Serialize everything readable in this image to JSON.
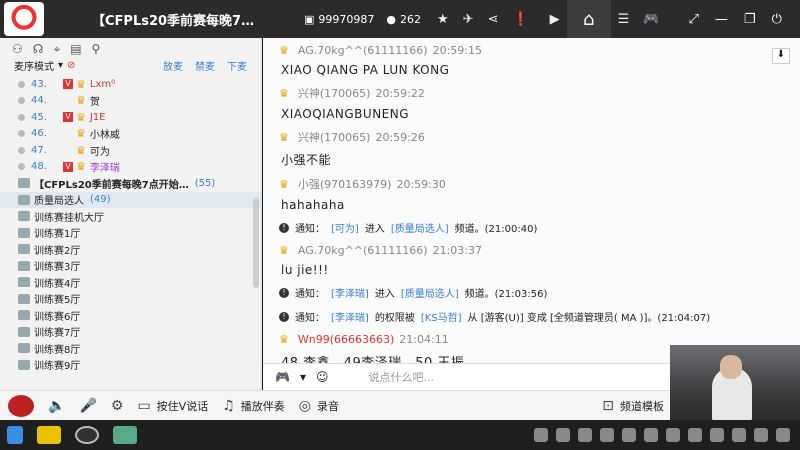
{
  "title_bar": {
    "room_title": "【CFPLs20季前赛每晚7…",
    "room_id": "99970987",
    "online_count": "262"
  },
  "left_panel": {
    "sort_mode": "麦序模式",
    "links": [
      "放麦",
      "禁麦",
      "下麦"
    ],
    "queue": [
      {
        "num": "43.",
        "name": "Lxm⁰",
        "v": true,
        "color": "#c33"
      },
      {
        "num": "44.",
        "name": "贺",
        "v": false,
        "color": "#222"
      },
      {
        "num": "45.",
        "name": "J1E",
        "v": true,
        "color": "#c33"
      },
      {
        "num": "46.",
        "name": "小林威",
        "v": false,
        "color": "#222"
      },
      {
        "num": "47.",
        "name": "可为",
        "v": false,
        "color": "#222"
      },
      {
        "num": "48.",
        "name": "李泽瑞",
        "v": true,
        "color": "#9a3bd1"
      }
    ],
    "channels": [
      {
        "name": "【CFPLs20季前赛每晚7点开始…",
        "count": "(55)",
        "bold": true
      },
      {
        "name": "质量局选人",
        "count": "(49)",
        "active": true
      },
      {
        "name": "训练赛挂机大厅",
        "count": ""
      },
      {
        "name": "训练赛1厅",
        "count": ""
      },
      {
        "name": "训练赛2厅",
        "count": ""
      },
      {
        "name": "训练赛3厅",
        "count": ""
      },
      {
        "name": "训练赛4厅",
        "count": ""
      },
      {
        "name": "训练赛5厅",
        "count": ""
      },
      {
        "name": "训练赛6厅",
        "count": ""
      },
      {
        "name": "训练赛7厅",
        "count": ""
      },
      {
        "name": "训练赛8厅",
        "count": ""
      },
      {
        "name": "训练赛9厅",
        "count": ""
      }
    ]
  },
  "chat": {
    "m1_user": "AG.70kg^^(61111166)",
    "m1_time": "20:59:15",
    "m1_text": "XIAO QIANG PA LUN KONG",
    "m2_user": "兴神(170065)",
    "m2_time": "20:59:22",
    "m2_text": "XIAOQIANGBUNENG",
    "m3_user": "兴神(170065)",
    "m3_time": "20:59:26",
    "m3_text": "小强不能",
    "m4_user": "小强(970163979)",
    "m4_time": "20:59:30",
    "m4_text": "hahahaha",
    "s1": {
      "label": "通知：",
      "user": "[可为]",
      "mid": "进入",
      "ch": "[质量局选人]",
      "end": "频道。(21:00:40)"
    },
    "m5_user": "AG.70kg^^(61111166)",
    "m5_time": "21:03:37",
    "m5_text": "lu jie!!!",
    "s2": {
      "label": "通知：",
      "user": "[李泽瑞]",
      "mid": "进入",
      "ch": "[质量局选人]",
      "end": "频道。(21:03:56)"
    },
    "s3": {
      "label": "通知：",
      "user": "[李泽瑞]",
      "mid": "的权限被",
      "ch": "[KS马哲]",
      "end": "从 [游客(U)] 变成 [全频道管理员( MA )]。(21:04:07)"
    },
    "m6_user": "Wn99(66663663)",
    "m6_time": "21:04:11",
    "m6_text": "48 李鑫　49李泽瑞　50 王振"
  },
  "input": {
    "placeholder": "说点什么吧..."
  },
  "toolbar": {
    "ptt": "按住V说话",
    "music": "播放伴奏",
    "record": "录音",
    "template": "频道模板"
  },
  "colors": {
    "accent": "#3a7dc9",
    "titlebar": "#2b2b2b",
    "crown": "#e9a100"
  }
}
